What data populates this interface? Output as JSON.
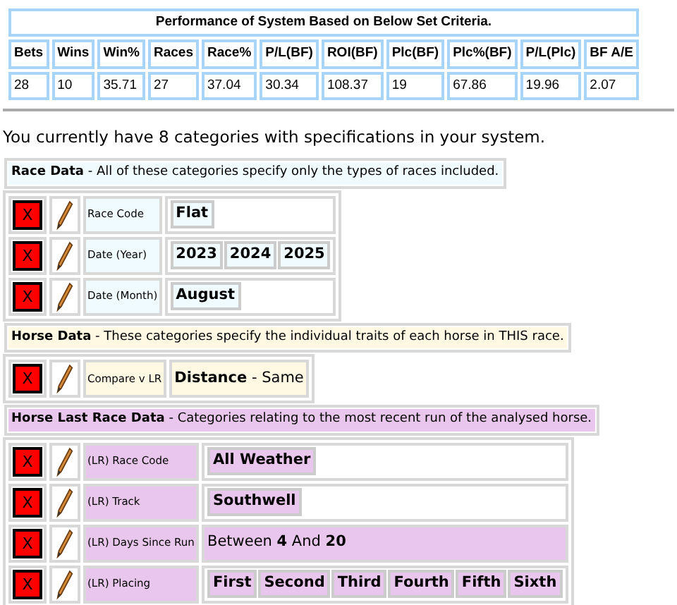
{
  "performance": {
    "title": "Performance of System Based on Below Set Criteria.",
    "columns": [
      "Bets",
      "Wins",
      "Win%",
      "Races",
      "Race%",
      "P/L(BF)",
      "ROI(BF)",
      "Plc(BF)",
      "Plc%(BF)",
      "P/L(Plc)",
      "BF A/E"
    ],
    "values": [
      "28",
      "10",
      "35.71",
      "27",
      "37.04",
      "30.34",
      "108.37",
      "19",
      "67.86",
      "19.96",
      "2.07"
    ]
  },
  "summary": "You currently have 8 categories with specifications in your system.",
  "sections": [
    {
      "kind": "race",
      "title": "Race Data",
      "description": " - All of these categories specify only the types of races included.",
      "rows": [
        {
          "delete": "X",
          "label": "Race Code",
          "value": {
            "kind": "chips",
            "chips": [
              "Flat"
            ]
          }
        },
        {
          "delete": "X",
          "label": "Date (Year)",
          "value": {
            "kind": "chips",
            "chips": [
              "2023",
              "2024",
              "2025"
            ]
          }
        },
        {
          "delete": "X",
          "label": "Date (Month)",
          "value": {
            "kind": "chips",
            "chips": [
              "August"
            ]
          }
        }
      ]
    },
    {
      "kind": "horse",
      "title": "Horse Data",
      "description": " - These categories specify the individual traits of each horse in THIS race.",
      "rows": [
        {
          "delete": "X",
          "label": "Compare v LR",
          "value": {
            "kind": "text",
            "text": "**Distance** - Same"
          }
        }
      ]
    },
    {
      "kind": "last_race",
      "title": "Horse Last Race Data",
      "description": " - Categories relating to the most recent run of the analysed horse.",
      "rows": [
        {
          "delete": "X",
          "label": "(LR) Race Code",
          "value": {
            "kind": "chips",
            "chips": [
              "All Weather"
            ]
          }
        },
        {
          "delete": "X",
          "label": "(LR) Track",
          "value": {
            "kind": "chips",
            "chips": [
              "Southwell"
            ]
          }
        },
        {
          "delete": "X",
          "label": "(LR) Days Since Run",
          "value": {
            "kind": "text",
            "text": "Between **4** And **20**"
          }
        },
        {
          "delete": "X",
          "label": "(LR) Placing",
          "value": {
            "kind": "chips",
            "chips": [
              "First",
              "Second",
              "Third",
              "Fourth",
              "Fifth",
              "Sixth"
            ]
          }
        }
      ]
    }
  ]
}
